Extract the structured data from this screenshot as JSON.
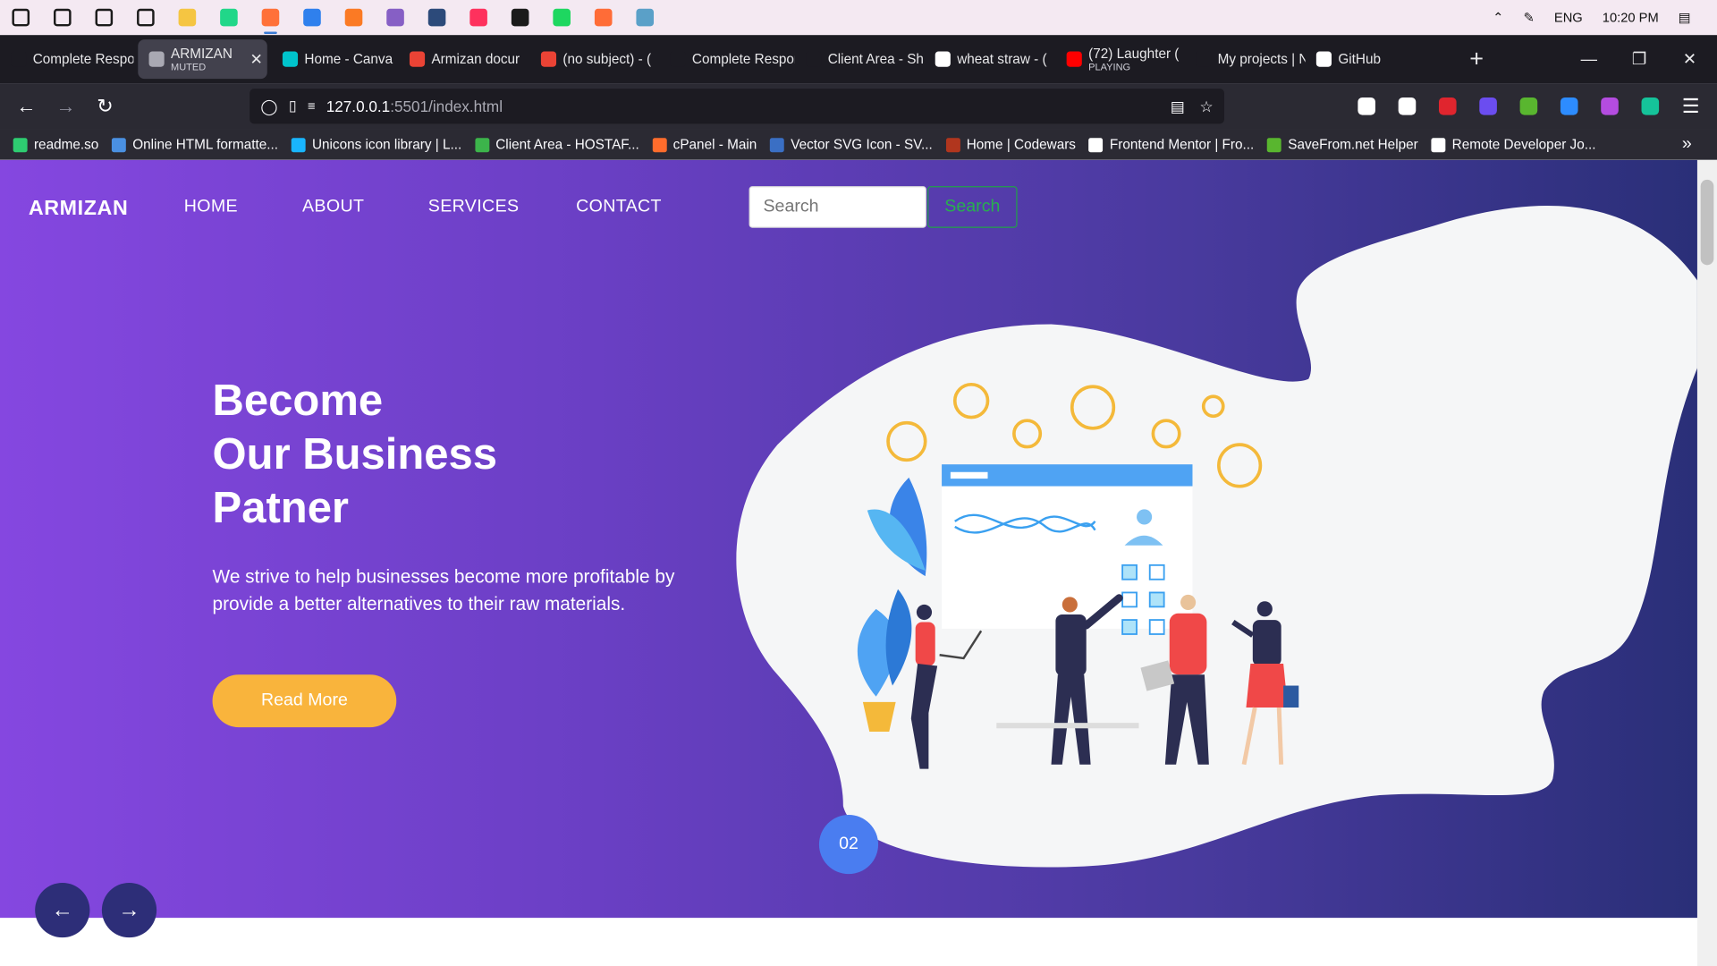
{
  "taskbar": {
    "icons": [
      {
        "name": "windows-start-icon",
        "color": "#1b1b1b"
      },
      {
        "name": "search-icon",
        "color": "#1b1b1b"
      },
      {
        "name": "cortana-icon",
        "color": "#1b1b1b"
      },
      {
        "name": "task-view-icon",
        "color": "#1b1b1b"
      },
      {
        "name": "file-explorer-icon",
        "color": "#f5c542"
      },
      {
        "name": "pycharm-icon",
        "color": "#21d789"
      },
      {
        "name": "firefox-icon",
        "color": "#ff7139"
      },
      {
        "name": "vscode-icon",
        "color": "#2f80ed"
      },
      {
        "name": "xampp-icon",
        "color": "#fb7a24"
      },
      {
        "name": "visual-studio-icon",
        "color": "#865fc5"
      },
      {
        "name": "ssms-icon",
        "color": "#2c4a7a"
      },
      {
        "name": "intellij-icon",
        "color": "#fe315d"
      },
      {
        "name": "obs-icon",
        "color": "#1b1b1b"
      },
      {
        "name": "spotify-icon",
        "color": "#1ed760"
      },
      {
        "name": "postman-icon",
        "color": "#ff6c37"
      },
      {
        "name": "monitor-icon",
        "color": "#5aa0c8"
      }
    ],
    "tray": {
      "language": "ENG",
      "time": "10:20 PM"
    }
  },
  "tabs": [
    {
      "label": "Complete Respon",
      "fav_color": "#1c1b22",
      "width": 122
    },
    {
      "label": "ARMIZAN",
      "sub": "MUTED",
      "active": true,
      "fav_color": "#a9a9b3",
      "width": 118
    },
    {
      "label": "Home - Canva",
      "fav_color": "#00c4cc",
      "width": 116
    },
    {
      "label": "Armizan docur",
      "fav_color": "#ea4335",
      "width": 120
    },
    {
      "label": "(no subject) - (",
      "fav_color": "#ea4335",
      "width": 118
    },
    {
      "label": "Complete Respon",
      "fav_color": "#1c1b22",
      "width": 124
    },
    {
      "label": "Client Area - Shuja",
      "fav_color": "#1c1b22",
      "width": 118
    },
    {
      "label": "wheat straw - (",
      "fav_color": "#ffffff",
      "width": 120
    },
    {
      "label": "(72) Laughter (",
      "sub": "PLAYING",
      "fav_color": "#ff0000",
      "width": 118
    },
    {
      "label": "My projects | N",
      "fav_color": "#1c1b22",
      "width": 110
    },
    {
      "label": "GitHub",
      "fav_color": "#ffffff",
      "width": 100
    }
  ],
  "nav": {
    "url_host": "127.0.0.1",
    "url_path": ":5501/index.html"
  },
  "extensions": [
    {
      "name": "pocket-icon",
      "color": "#ffffff"
    },
    {
      "name": "download-icon",
      "color": "#ffffff"
    },
    {
      "name": "ublock-icon",
      "color": "#e0252e"
    },
    {
      "name": "extension-purple-icon",
      "color": "#6b4df0"
    },
    {
      "name": "savefrom-icon",
      "color": "#59b62f"
    },
    {
      "name": "zoom-icon",
      "color": "#2d8cff"
    },
    {
      "name": "extension-wave-icon",
      "color": "#b44ce0"
    },
    {
      "name": "grammarly-icon",
      "color": "#15c39a"
    }
  ],
  "bookmarks": [
    {
      "label": "readme.so",
      "fav_color": "#2ecc71"
    },
    {
      "label": "Online HTML formatte...",
      "fav_color": "#4a90e2"
    },
    {
      "label": "Unicons icon library | L...",
      "fav_color": "#19b5fe"
    },
    {
      "label": "Client Area - HOSTAF...",
      "fav_color": "#3cb44b"
    },
    {
      "label": "cPanel - Main",
      "fav_color": "#ff6c2c"
    },
    {
      "label": "Vector SVG Icon - SV...",
      "fav_color": "#3a6fc4"
    },
    {
      "label": "Home | Codewars",
      "fav_color": "#b1361e"
    },
    {
      "label": "Frontend Mentor | Fro...",
      "fav_color": "#ffffff"
    },
    {
      "label": "SaveFrom.net Helper",
      "fav_color": "#59b62f"
    },
    {
      "label": "Remote Developer Jo...",
      "fav_color": "#ffffff"
    }
  ],
  "page": {
    "brand": "ARMIZAN",
    "menu": [
      "HOME",
      "ABOUT",
      "SERVICES",
      "CONTACT"
    ],
    "search_placeholder": "Search",
    "search_button": "Search",
    "headline": [
      "Become",
      "Our Business",
      "Patner"
    ],
    "subtext": "We strive to help businesses become more profitable by provide a better alternatives to their raw materials.",
    "cta": "Read More",
    "slide": "02",
    "colors": {
      "gradient_start": "#8547e0",
      "gradient_end": "#2a2f78",
      "cta": "#f9b43c",
      "search_green": "#28b04f",
      "slide_blue": "#4a7df0",
      "arrow_navy": "#2d2e78"
    }
  }
}
